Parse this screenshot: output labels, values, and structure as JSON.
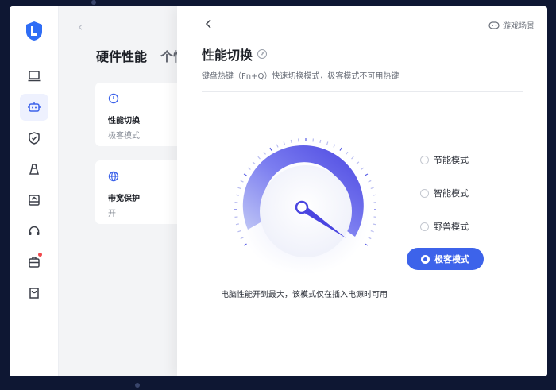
{
  "background_page": {
    "title": "硬件性能",
    "title_partial": "个性",
    "cards": [
      {
        "icon": "performance-icon",
        "title": "性能切换",
        "value": "极客模式"
      },
      {
        "icon": "globe-icon",
        "title": "带宽保护",
        "value": "开"
      }
    ]
  },
  "panel": {
    "title": "性能切换",
    "subtitle": "键盘热键（Fn+Q）快速切换模式，极客模式不可用热键",
    "game_link": "游戏场景",
    "gauge_note": "电脑性能开到最大，该模式仅在插入电源时可用",
    "modes": [
      {
        "label": "节能模式",
        "selected": false
      },
      {
        "label": "智能模式",
        "selected": false
      },
      {
        "label": "野兽模式",
        "selected": false
      },
      {
        "label": "极客模式",
        "selected": true
      }
    ]
  },
  "colors": {
    "accent": "#3d63ea",
    "gauge_gradient_start": "#a9b6f5",
    "gauge_gradient_end": "#4a45e0"
  },
  "sidebar": {
    "items": [
      "laptop-icon",
      "robot-icon",
      "shield-icon",
      "cleaner-icon",
      "storage-icon",
      "headset-icon",
      "toolbox-icon",
      "bag-icon"
    ]
  }
}
